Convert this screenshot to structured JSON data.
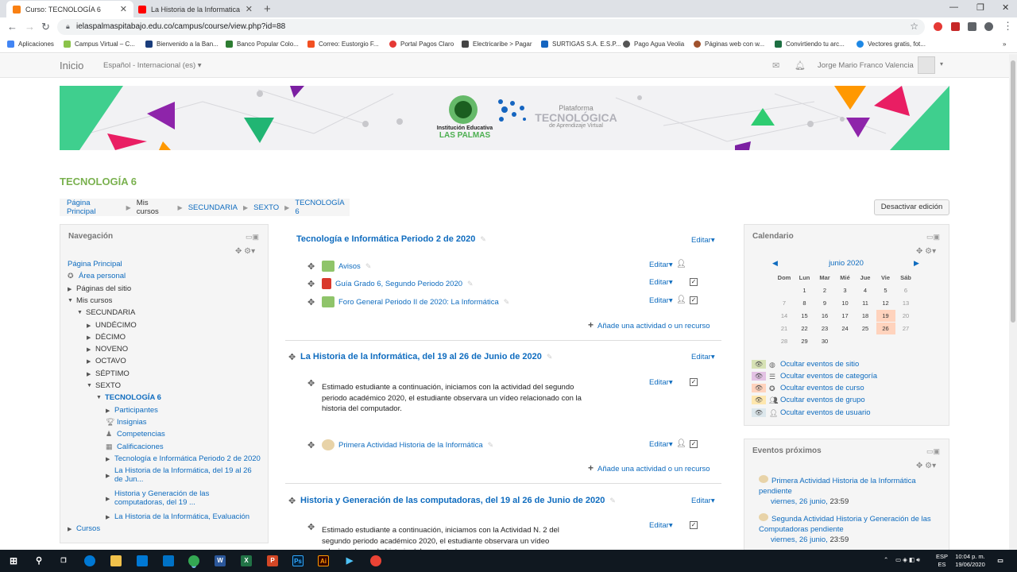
{
  "browser": {
    "tabs": [
      {
        "title": "Curso: TECNOLOGÍA 6",
        "active": true
      },
      {
        "title": "La Historia de la Informatica en i...",
        "active": false
      }
    ],
    "url": "ielaspalmaspitabajo.edu.co/campus/course/view.php?id=88",
    "bookmarks": [
      "Aplicaciones",
      "Campus Virtual – C...",
      "Bienvenido a la Ban...",
      "Banco Popular Colo...",
      "Correo: Eustorgio F...",
      "Portal Pagos Claro",
      "Electricaribe > Pagar",
      "SURTIGAS S.A. E.S.P...",
      "Pago Agua Veolia",
      "Páginas web con w...",
      "Convirtiendo tu arc...",
      "Vectores gratis, fot..."
    ]
  },
  "navbar": {
    "brand": "Inicio",
    "language": "Español - Internacional (es)",
    "user": "Jorge Mario Franco Valencia"
  },
  "banner": {
    "school_line1": "Institución Educativa",
    "school_line2": "LAS PALMAS",
    "platform_line1": "Plataforma",
    "platform_line2": "TECNOLÓGICA",
    "platform_line3": "de Aprendizaje Virtual"
  },
  "course_title": "TECNOLOGÍA 6",
  "breadcrumb": [
    "Página Principal",
    "Mis cursos",
    "SECUNDARIA",
    "SEXTO",
    "TECNOLOGÍA 6"
  ],
  "edit_toggle": "Desactivar edición",
  "navigation": {
    "title": "Navegación",
    "items": [
      "Página Principal",
      "Área personal",
      "Páginas del sitio",
      "Mis cursos",
      "SECUNDARIA",
      "UNDÉCIMO",
      "DÉCIMO",
      "NOVENO",
      "OCTAVO",
      "SÉPTIMO",
      "SEXTO",
      "TECNOLOGÍA 6",
      "Participantes",
      "Insignias",
      "Competencias",
      "Calificaciones",
      "Tecnología e Informática Periodo 2 de 2020",
      "La Historia de la Informática, del 19 al 26",
      "de Jun...",
      "Historia y Generación de las",
      "computadoras, del 19 ...",
      "La Historia de la Informática, Evaluación",
      "Cursos"
    ]
  },
  "content": {
    "edit_label": "Editar",
    "add_activity": "Añade una actividad o un recurso",
    "sections": [
      {
        "title": "Tecnología e Informática Periodo 2 de 2020",
        "activities": [
          "Avisos",
          "Guía Grado 6, Segundo Periodo 2020",
          "Foro General Periodo II de 2020: La Informática"
        ]
      },
      {
        "title": "La Historia de la Informática, del 19 al 26 de Junio de 2020",
        "text": "Estimado estudiante a continuación, iniciamos con la actividad del segundo periodo académico 2020, el estudiante observara un vídeo relacionado con la historia del computador.",
        "activities": [
          "Primera Actividad Historia de la Informática"
        ]
      },
      {
        "title": "Historia y Generación de las computadoras, del 19 al 26 de Junio de 2020",
        "text": "Estimado estudiante a continuación, iniciamos con la Actividad N. 2 del segundo periodo académico 2020, el estudiante observara un vídeo relacionado con la historia del computador."
      }
    ]
  },
  "calendar": {
    "title": "Calendario",
    "month": "junio 2020",
    "days": [
      "Dom",
      "Lun",
      "Mar",
      "Mié",
      "Jue",
      "Vie",
      "Sáb"
    ],
    "weeks": [
      [
        "",
        "1",
        "2",
        "3",
        "4",
        "5",
        "6"
      ],
      [
        "7",
        "8",
        "9",
        "10",
        "11",
        "12",
        "13"
      ],
      [
        "14",
        "15",
        "16",
        "17",
        "18",
        "19",
        "20"
      ],
      [
        "21",
        "22",
        "23",
        "24",
        "25",
        "26",
        "27"
      ],
      [
        "28",
        "29",
        "30",
        "",
        "",
        "",
        ""
      ]
    ],
    "event_days": [
      "19",
      "26"
    ],
    "filters": [
      "Ocultar eventos de sitio",
      "Ocultar eventos de categoría",
      "Ocultar eventos de curso",
      "Ocultar eventos de grupo",
      "Ocultar eventos de usuario"
    ],
    "filter_colors": [
      "#d7e2b5",
      "#e3c2e4",
      "#ffd3bd",
      "#fee7ae",
      "#dce7ec"
    ]
  },
  "upcoming": {
    "title": "Eventos próximos",
    "events": [
      {
        "name": "Primera Actividad Historia de la Informática pendiente",
        "date": "viernes, 26 junio,",
        "time": "23:59"
      },
      {
        "name": "Segunda Actividad Historia y Generación de las Computadoras pendiente",
        "date": "viernes, 26 junio,",
        "time": "23:59"
      }
    ]
  },
  "taskbar": {
    "lang1": "ESP",
    "lang2": "ES",
    "time": "10:04 p. m.",
    "date": "19/06/2020"
  }
}
